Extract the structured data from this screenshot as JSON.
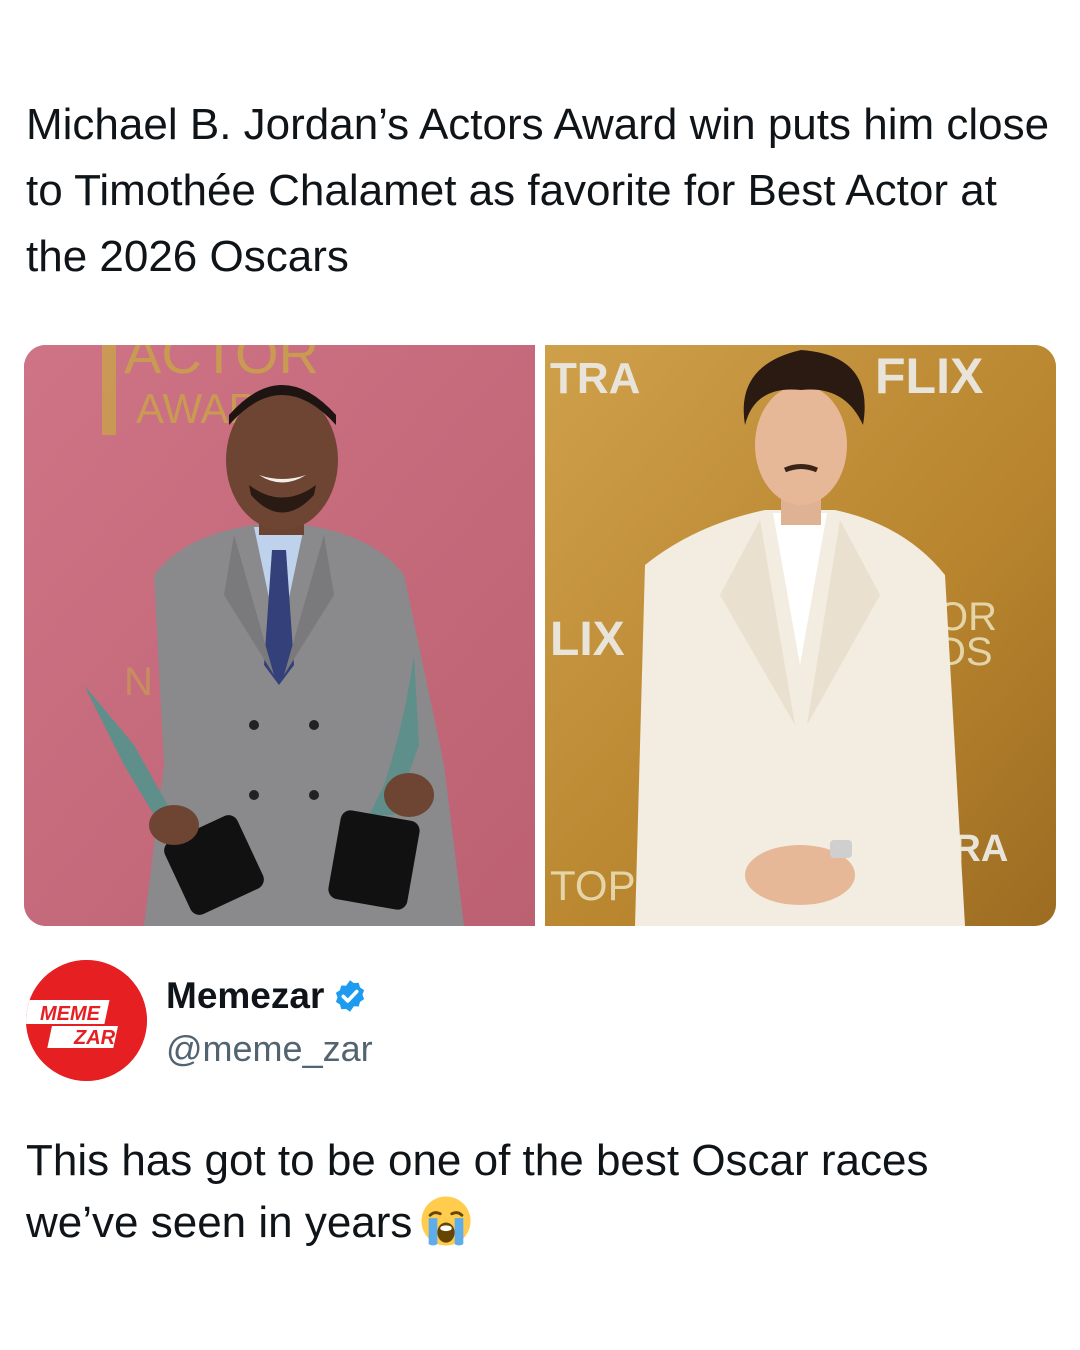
{
  "headline": "Michael B. Jordan’s Actors Award win puts him close to Timothée Chalamet as favorite for Best Actor at the 2026 Oscars",
  "media": {
    "left_backdrop_text_1": "ACTOR",
    "left_backdrop_text_2": "AWARDS",
    "left_backdrop_text_3": "N",
    "right_backdrop_text_1": "TRA",
    "right_backdrop_text_2": "FLIX",
    "right_backdrop_text_3": "LIX",
    "right_backdrop_text_4": "OR",
    "right_backdrop_text_5": "DS",
    "right_backdrop_text_6": "FTRA",
    "right_backdrop_text_7": "TOP"
  },
  "author": {
    "name": "Memezar",
    "handle": "@meme_zar",
    "avatar_text_1": "MEME",
    "avatar_text_2": "ZAR",
    "avatar_color": "#e51f22",
    "verified_icon": "verified-badge-icon",
    "verified_color": "#1d9bf0"
  },
  "post": {
    "text": "This has got to be one of the best Oscar races we’ve seen in years",
    "emoji_icon": "loudly-crying-face-icon"
  }
}
